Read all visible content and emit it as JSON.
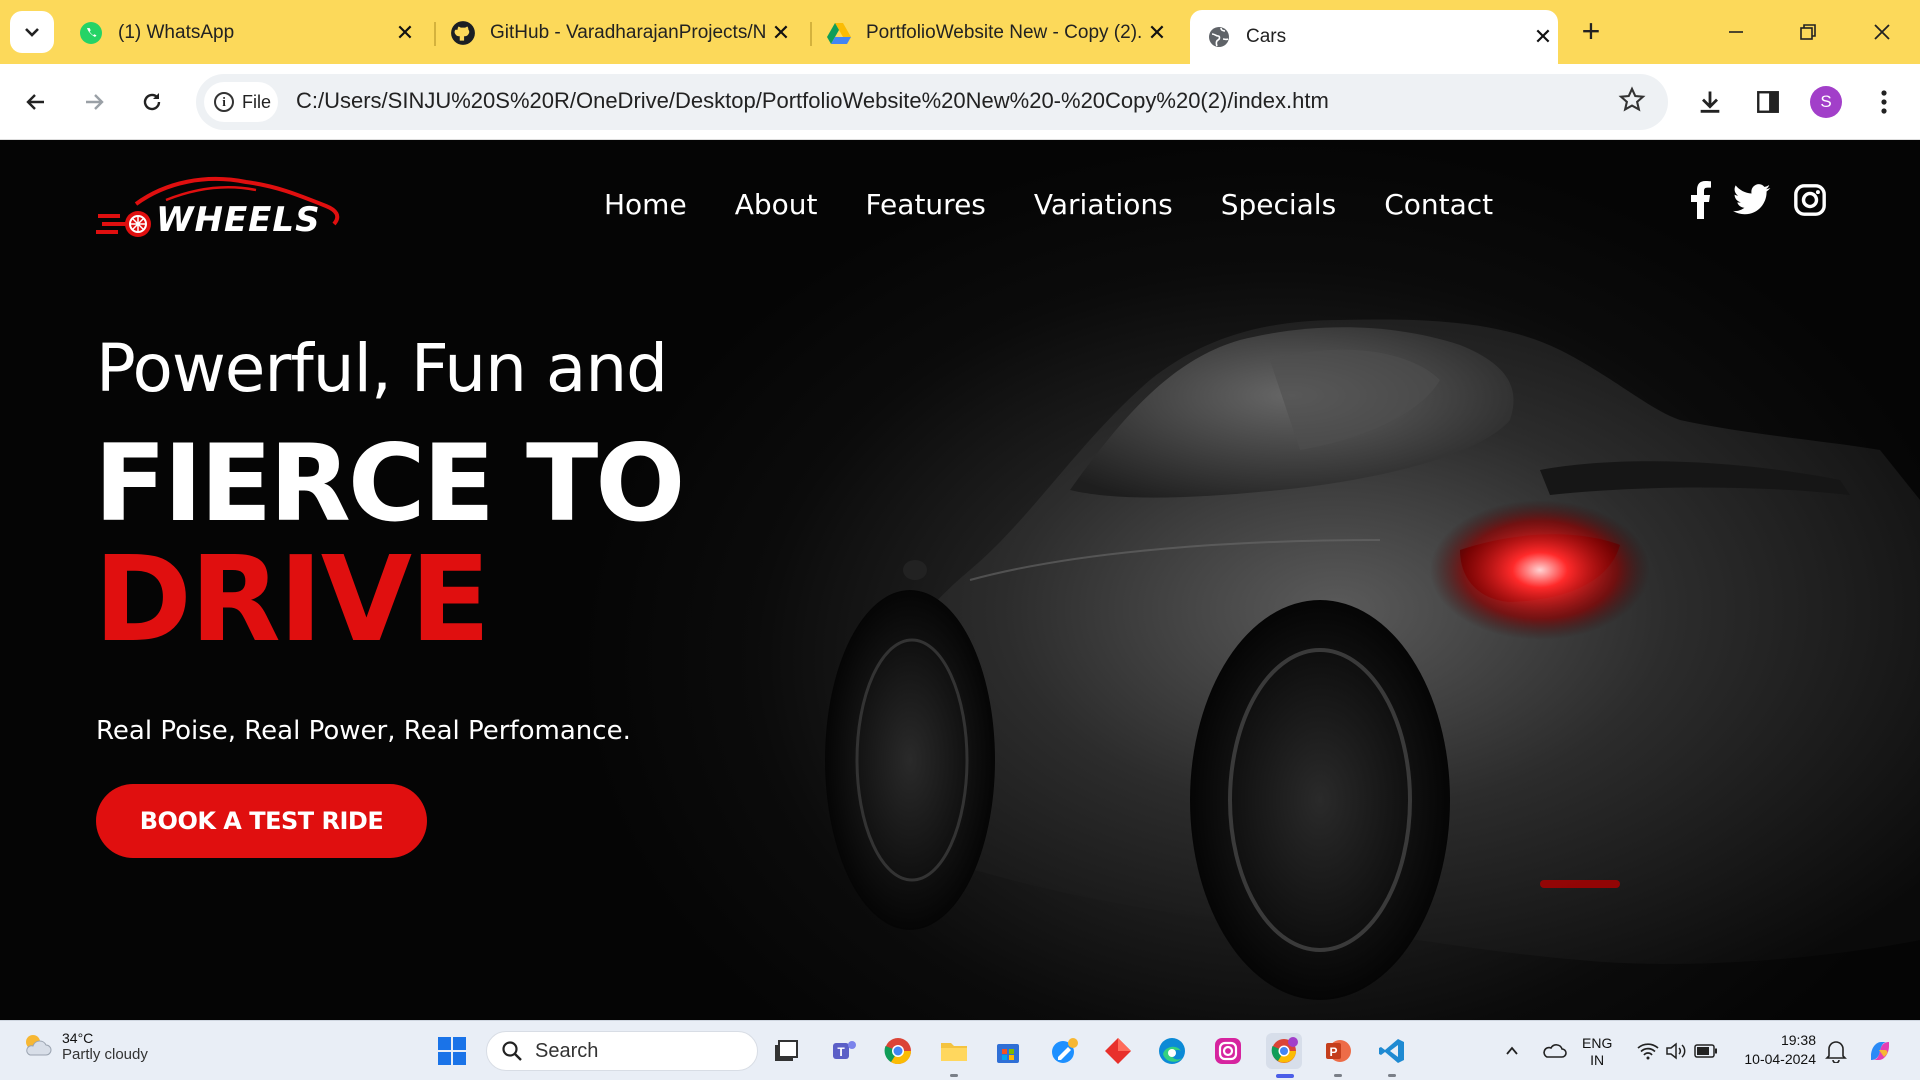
{
  "browser": {
    "tabs": [
      {
        "title": "(1) WhatsApp",
        "icon": "whatsapp-icon",
        "active": false
      },
      {
        "title": "GitHub - VaradharajanProjects/N",
        "icon": "github-icon",
        "active": false
      },
      {
        "title": "PortfolioWebsite New - Copy (2).",
        "icon": "google-drive-icon",
        "active": false
      },
      {
        "title": "Cars",
        "icon": "globe-icon",
        "active": true
      }
    ],
    "new_tab_symbol": "+",
    "address": {
      "chip_label": "File",
      "url": "C:/Users/SINJU%20S%20R/OneDrive/Desktop/PortfolioWebsite%20New%20-%20Copy%20(2)/index.htm"
    },
    "profile_initial": "S",
    "accent_tabstrip": "#fcd95a"
  },
  "site": {
    "logo_text": "WHEELS",
    "nav": [
      "Home",
      "About",
      "Features",
      "Variations",
      "Specials",
      "Contact"
    ],
    "social": [
      "facebook-icon",
      "twitter-icon",
      "instagram-icon"
    ],
    "hero": {
      "line1": "Powerful, Fun and",
      "line2": "FIERCE TO",
      "line3": "DRIVE",
      "tagline": "Real Poise, Real Power, Real Perfomance.",
      "cta": "BOOK A TEST RIDE"
    },
    "accent": "#e00f0f"
  },
  "taskbar": {
    "weather_temp": "34°C",
    "weather_cond": "Partly cloudy",
    "search_placeholder": "Search",
    "lang_top": "ENG",
    "lang_bottom": "IN",
    "time": "19:38",
    "date": "10-04-2024"
  }
}
